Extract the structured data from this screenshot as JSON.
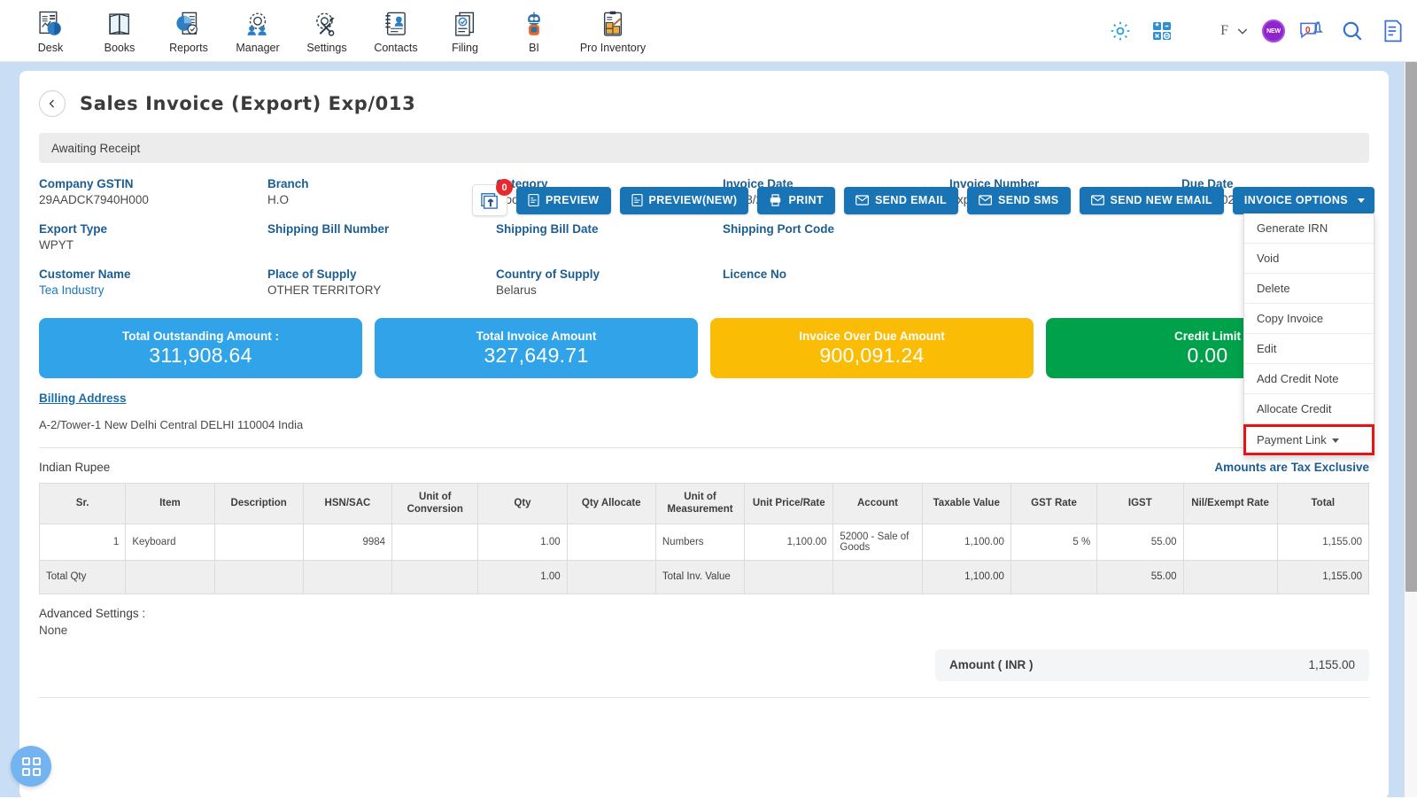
{
  "topnav": {
    "items": [
      {
        "label": "Desk",
        "icon": "desk-chart-document-icon"
      },
      {
        "label": "Books",
        "icon": "open-book-icon"
      },
      {
        "label": "Reports",
        "icon": "pie-chart-report-icon"
      },
      {
        "label": "Manager",
        "icon": "gear-people-icon"
      },
      {
        "label": "Settings",
        "icon": "gear-wrench-icon"
      },
      {
        "label": "Contacts",
        "icon": "contact-card-icon"
      },
      {
        "label": "Filing",
        "icon": "filing-documents-icon"
      },
      {
        "label": "BI",
        "icon": "robot-bi-icon"
      },
      {
        "label": "Pro Inventory",
        "icon": "clipboard-boxes-icon"
      }
    ],
    "right": {
      "gear": "gear-icon",
      "calculator": "calculator-icon",
      "user_initial": "F",
      "new_badge": "NEW",
      "chat_count": "0",
      "search": "search-icon",
      "notes": "document-notes-icon"
    }
  },
  "header": {
    "back": "‹",
    "title": "Sales Invoice (Export) Exp/013"
  },
  "toolbar": {
    "attach_badge": "0",
    "buttons": [
      {
        "label": "PREVIEW",
        "icon": "pdf-preview-icon"
      },
      {
        "label": "PREVIEW(NEW)",
        "icon": "pdf-preview-icon"
      },
      {
        "label": "PRINT",
        "icon": "printer-icon"
      },
      {
        "label": "SEND EMAIL",
        "icon": "envelope-icon"
      },
      {
        "label": "SEND SMS",
        "icon": "envelope-icon"
      },
      {
        "label": "SEND NEW EMAIL",
        "icon": "envelope-icon"
      }
    ],
    "options_label": "INVOICE OPTIONS"
  },
  "dropdown": {
    "items": [
      {
        "label": "Generate IRN",
        "highlighted": false,
        "caret": false
      },
      {
        "label": "Void",
        "highlighted": false,
        "caret": false
      },
      {
        "label": "Delete",
        "highlighted": false,
        "caret": false
      },
      {
        "label": "Copy Invoice",
        "highlighted": false,
        "caret": false
      },
      {
        "label": "Edit",
        "highlighted": false,
        "caret": false
      },
      {
        "label": "Add Credit Note",
        "highlighted": false,
        "caret": false
      },
      {
        "label": "Allocate Credit",
        "highlighted": false,
        "caret": false
      },
      {
        "label": "Payment Link",
        "highlighted": true,
        "caret": true
      }
    ],
    "highlight_color": "#e61515"
  },
  "status": {
    "text": "Awaiting Receipt"
  },
  "fields": {
    "row1": [
      {
        "label": "Company GSTIN",
        "value": "29AADCK7940H000"
      },
      {
        "label": "Branch",
        "value": "H.O"
      },
      {
        "label": "Category",
        "value": "Goods"
      },
      {
        "label": "Invoice Date",
        "value": "03/08/2021"
      },
      {
        "label": "Invoice Number",
        "value": "Exp/013"
      },
      {
        "label": "Due Date",
        "value": "13/08/2021"
      }
    ],
    "row2": [
      {
        "label": "Export Type",
        "value": "WPYT"
      },
      {
        "label": "Shipping Bill Number",
        "value": ""
      },
      {
        "label": "Shipping Bill Date",
        "value": ""
      },
      {
        "label": "Shipping Port Code",
        "value": ""
      },
      {
        "label": "",
        "value": ""
      },
      {
        "label": "",
        "value": ""
      }
    ],
    "row3": [
      {
        "label": "Customer Name",
        "value": "Tea Industry",
        "link": true
      },
      {
        "label": "Place of Supply",
        "value": "OTHER TERRITORY"
      },
      {
        "label": "Country of Supply",
        "value": "Belarus"
      },
      {
        "label": "Licence No",
        "value": ""
      },
      {
        "label": "",
        "value": ""
      },
      {
        "label": "",
        "value": ""
      }
    ]
  },
  "summary_cards": [
    {
      "label": "Total Outstanding Amount :",
      "value": "311,908.64",
      "color": "#31a3e8"
    },
    {
      "label": "Total Invoice Amount",
      "value": "327,649.71",
      "color": "#31a3e8"
    },
    {
      "label": "Invoice Over Due Amount",
      "value": "900,091.24",
      "color": "#fbbc05"
    },
    {
      "label": "Credit Limit",
      "value": "0.00",
      "color": "#00a14b"
    }
  ],
  "billing": {
    "title": "Billing Address",
    "address": "A-2/Tower-1 New Delhi Central DELHI 110004 India"
  },
  "currency_row": {
    "currency": "Indian Rupee",
    "tax_note": "Amounts are Tax Exclusive"
  },
  "line_table": {
    "headers": [
      "Sr.",
      "Item",
      "Description",
      "HSN/SAC",
      "Unit of Conversion",
      "Qty",
      "Qty Allocate",
      "Unit of Measurement",
      "Unit Price/Rate",
      "Account",
      "Taxable Value",
      "GST Rate",
      "IGST",
      "Nil/Exempt Rate",
      "Total"
    ],
    "rows": [
      {
        "sr": "1",
        "item": "Keyboard",
        "description": "",
        "hsn_sac": "9984",
        "unit_of_conversion": "",
        "qty": "1.00",
        "qty_allocate": "",
        "unit_of_measurement": "Numbers",
        "unit_price_rate": "1,100.00",
        "account": "52000 - Sale of Goods",
        "taxable_value": "1,100.00",
        "gst_rate": "5 %",
        "igst": "55.00",
        "nil_exempt_rate": "",
        "total": "1,155.00"
      }
    ],
    "totals": {
      "total_qty_label": "Total Qty",
      "qty": "1.00",
      "total_inv_value_label": "Total Inv. Value",
      "taxable_value": "1,100.00",
      "igst": "55.00",
      "total": "1,155.00"
    }
  },
  "advanced": {
    "label": "Advanced Settings :",
    "value": "None"
  },
  "amount_bar": {
    "label": "Amount ( INR )",
    "value": "1,155.00"
  },
  "fab": {
    "icon": "grid-apps-icon"
  }
}
